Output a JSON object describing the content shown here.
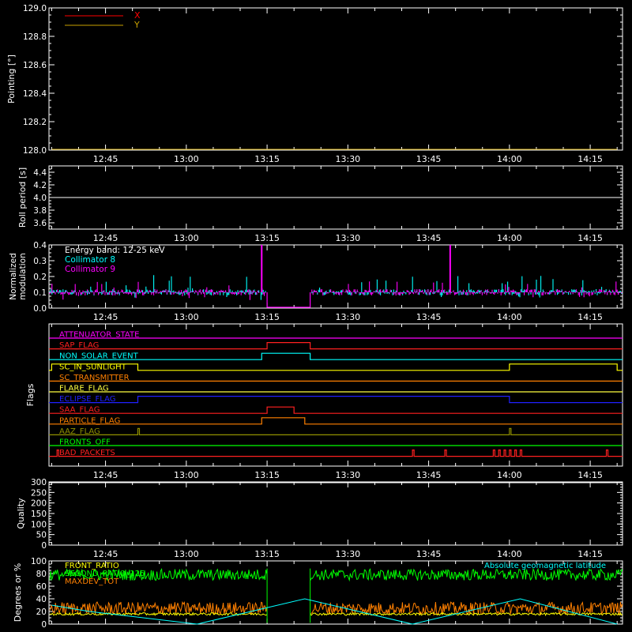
{
  "chart_data": [
    {
      "type": "line",
      "panel": "pointing",
      "ylabel": "Pointing [°]",
      "ylim": [
        128.0,
        129.0
      ],
      "yticks": [
        "128.0",
        "128.2",
        "128.4",
        "128.6",
        "128.8",
        "129.0"
      ],
      "xtick_labels": [
        "12:45",
        "13:00",
        "13:15",
        "13:30",
        "13:45",
        "14:00",
        "14:15"
      ],
      "legend": [
        {
          "name": "X",
          "color": "#ff0000"
        },
        {
          "name": "Y",
          "color": "#c8a000"
        }
      ],
      "series": [
        {
          "name": "Y",
          "color": "#c8a000",
          "x": [
            "12:35",
            "14:20"
          ],
          "values": [
            128.0,
            128.0
          ]
        }
      ]
    },
    {
      "type": "line",
      "panel": "roll",
      "ylabel": "Roll period [s]",
      "ylim": [
        3.5,
        4.5
      ],
      "yticks": [
        "3.6",
        "3.8",
        "4.0",
        "4.2",
        "4.4"
      ],
      "xtick_labels": [
        "12:45",
        "13:00",
        "13:15",
        "13:30",
        "13:45",
        "14:00",
        "14:15"
      ],
      "series": [
        {
          "name": "",
          "color": "#ffffff",
          "x": [
            "12:35",
            "14:20"
          ],
          "values": [
            4.0,
            4.0
          ]
        }
      ]
    },
    {
      "type": "line",
      "panel": "modulation",
      "ylabel_lines": [
        "Normalized",
        "modulation"
      ],
      "ylim": [
        0.0,
        0.4
      ],
      "yticks": [
        "0.0",
        "0.1",
        "0.2",
        "0.3",
        "0.4"
      ],
      "xtick_labels": [
        "12:45",
        "13:00",
        "13:15",
        "13:30",
        "13:45",
        "14:00",
        "14:15"
      ],
      "legend": [
        {
          "name": "Energy band: 12-25 keV",
          "color": "#ffffff"
        },
        {
          "name": "Collimator 8",
          "color": "#00ffff"
        },
        {
          "name": "Collimator 9",
          "color": "#ff00ff"
        }
      ],
      "gap": [
        "13:15",
        "13:23"
      ],
      "spikes": [
        {
          "series": "Collimator 9",
          "x": "13:14",
          "value": 0.4
        },
        {
          "series": "Collimator 9",
          "x": "13:49",
          "value": 0.4
        }
      ]
    },
    {
      "type": "timeline",
      "panel": "flags",
      "ylabel": "Flags",
      "xtick_labels": [
        "12:45",
        "13:00",
        "13:15",
        "13:30",
        "13:45",
        "14:00",
        "14:15"
      ],
      "flags": [
        {
          "name": "ATTENUATOR_STATE",
          "color": "#ff00ff",
          "high": []
        },
        {
          "name": "SAP_FLAG",
          "color": "#ff2020",
          "high": [
            [
              "13:15",
              "13:23"
            ]
          ]
        },
        {
          "name": "NON_SOLAR_EVENT",
          "color": "#00ffff",
          "high": [
            [
              "13:14",
              "13:23"
            ]
          ]
        },
        {
          "name": "SC_IN_SUNLIGHT",
          "color": "#ffff00",
          "high": [
            [
              "12:35",
              "12:51"
            ],
            [
              "14:00",
              "14:20"
            ]
          ]
        },
        {
          "name": "SC_TRANSMITTER",
          "color": "#ff8000",
          "high": []
        },
        {
          "name": "FLARE_FLAG",
          "color": "#ffff40",
          "high": []
        },
        {
          "name": "ECLIPSE_FLAG",
          "color": "#2020ff",
          "high": [
            [
              "12:51",
              "14:00"
            ]
          ]
        },
        {
          "name": "SAA_FLAG",
          "color": "#ff2020",
          "high": [
            [
              "13:15",
              "13:20"
            ]
          ]
        },
        {
          "name": "PARTICLE_FLAG",
          "color": "#ff8000",
          "high": [
            [
              "13:14",
              "13:22"
            ]
          ]
        },
        {
          "name": "AAZ_FLAG",
          "color": "#909000",
          "high": [
            [
              "12:51",
              "12:51"
            ],
            [
              "14:00",
              "14:00"
            ]
          ]
        },
        {
          "name": "FRONTS_OFF",
          "color": "#00ff00",
          "high": []
        },
        {
          "name": "BAD_PACKETS",
          "color": "#ff2020",
          "high": [
            [
              "12:36",
              "12:36"
            ],
            [
              "13:42",
              "13:42"
            ],
            [
              "13:48",
              "13:48"
            ],
            [
              "13:57",
              "13:57"
            ],
            [
              "13:58",
              "13:58"
            ],
            [
              "13:59",
              "13:59"
            ],
            [
              "14:00",
              "14:00"
            ],
            [
              "14:01",
              "14:01"
            ],
            [
              "14:02",
              "14:02"
            ],
            [
              "14:18",
              "14:18"
            ]
          ]
        }
      ]
    },
    {
      "type": "line",
      "panel": "quality",
      "ylabel": "Quality",
      "ylim": [
        0,
        300
      ],
      "yticks": [
        "0",
        "50",
        "100",
        "150",
        "200",
        "250",
        "300"
      ],
      "xtick_labels": [
        "12:45",
        "13:00",
        "13:15",
        "13:30",
        "13:45",
        "14:00",
        "14:15"
      ],
      "series": [
        {
          "name": "",
          "color": "#ffffff",
          "x": [
            "12:35",
            "14:20"
          ],
          "values": [
            300,
            300
          ]
        }
      ]
    },
    {
      "type": "line",
      "panel": "ratios",
      "ylabel": "Degrees or %",
      "ylim": [
        0,
        100
      ],
      "yticks": [
        "0",
        "20",
        "40",
        "60",
        "80",
        "100"
      ],
      "legend": [
        {
          "name": "FRONT_RATIO",
          "color": "#ffff00"
        },
        {
          "name": "SECOND_RATIO_125",
          "color": "#00ff00"
        },
        {
          "name": "MAXDEV_TOT",
          "color": "#ff8000"
        }
      ],
      "right_legend": {
        "name": "Absolute geomagnetic latitude",
        "color": "#00ffff"
      },
      "gap": [
        "13:15",
        "13:23"
      ],
      "latitude": {
        "x": [
          "12:35",
          "12:42",
          "13:02",
          "13:22",
          "13:42",
          "14:02",
          "14:20"
        ],
        "values": [
          30,
          20,
          0,
          40,
          0,
          40,
          0
        ]
      }
    }
  ]
}
